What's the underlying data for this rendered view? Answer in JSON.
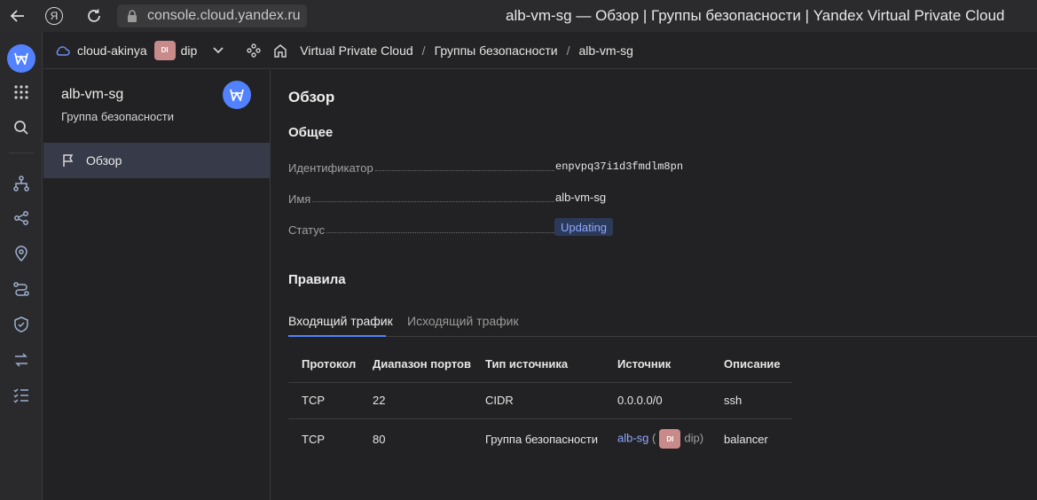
{
  "browser": {
    "url": "console.cloud.yandex.ru",
    "page_title": "alb-vm-sg — Обзор | Группы безопасности | Yandex Virtual Private Cloud",
    "yandex_button_label": "Я"
  },
  "rail": {
    "icons": [
      "vpc-logo-icon",
      "apps-grid-icon",
      "search-icon",
      "network-icon",
      "share-icon",
      "location-pin-icon",
      "routes-icon",
      "shield-icon",
      "transfer-icon",
      "checklist-icon"
    ]
  },
  "header": {
    "cloud_name": "cloud-akinya",
    "folder_badge": "DI",
    "folder_name": "dip",
    "breadcrumbs": [
      "Virtual Private Cloud",
      "Группы безопасности",
      "alb-vm-sg"
    ]
  },
  "sidebar": {
    "title": "alb-vm-sg",
    "subtitle": "Группа безопасности",
    "nav": [
      {
        "label": "Обзор",
        "active": true
      }
    ]
  },
  "main": {
    "heading": "Обзор",
    "general_heading": "Общее",
    "properties": {
      "id_label": "Идентификатор",
      "id_value": "enpvpq37i1d3fmdlm8pn",
      "name_label": "Имя",
      "name_value": "alb-vm-sg",
      "status_label": "Статус",
      "status_value": "Updating"
    },
    "rules_heading": "Правила",
    "tabs": [
      {
        "label": "Входящий трафик",
        "active": true
      },
      {
        "label": "Исходящий трафик",
        "active": false
      }
    ],
    "table": {
      "headers": [
        "Протокол",
        "Диапазон портов",
        "Тип источника",
        "Источник",
        "Описание"
      ],
      "rows": [
        {
          "protocol": "TCP",
          "ports": "22",
          "source_type": "CIDR",
          "source": "0.0.0.0/0",
          "description": "ssh"
        },
        {
          "protocol": "TCP",
          "ports": "80",
          "source_type": "Группа безопасности",
          "source": "alb-sg",
          "source_paren_open": "(",
          "source_folder_badge": "DI",
          "source_folder": "dip)",
          "description": "balancer"
        }
      ]
    }
  },
  "colors": {
    "accent": "#5282ff",
    "background": "#222224",
    "status_badge_bg": "#2c3a5a",
    "folder_badge_bg": "#c98a8a"
  }
}
